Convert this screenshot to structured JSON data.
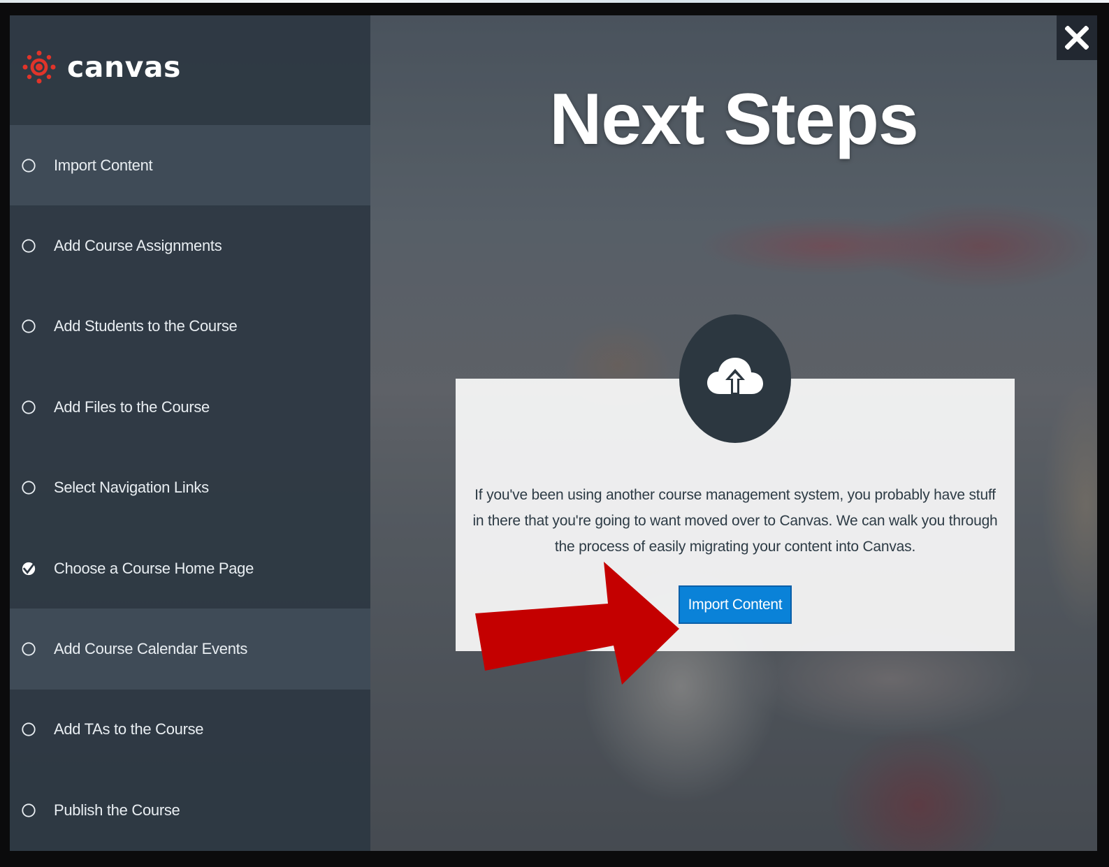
{
  "brand": {
    "name": "canvas"
  },
  "page": {
    "title": "Next Steps"
  },
  "steps": [
    {
      "label": "Import Content",
      "status": "open",
      "active": true
    },
    {
      "label": "Add Course Assignments",
      "status": "open",
      "active": false
    },
    {
      "label": "Add Students to the Course",
      "status": "open",
      "active": false
    },
    {
      "label": "Add Files to the Course",
      "status": "open",
      "active": false
    },
    {
      "label": "Select Navigation Links",
      "status": "open",
      "active": false
    },
    {
      "label": "Choose a Course Home Page",
      "status": "done",
      "active": false
    },
    {
      "label": "Add Course Calendar Events",
      "status": "open",
      "active": true
    },
    {
      "label": "Add TAs to the Course",
      "status": "open",
      "active": false
    },
    {
      "label": "Publish the Course",
      "status": "open",
      "active": false
    }
  ],
  "card": {
    "icon": "cloud-upload-icon",
    "description": "If you've been using another course management system, you probably have stuff in there that you're going to want moved over to Canvas. We can walk you through the process of easily migrating your content into Canvas.",
    "button_label": "Import Content"
  },
  "colors": {
    "brand_red": "#e1342a",
    "button_blue": "#0a82d8",
    "annotation_arrow": "#c40000",
    "sidebar": "#2c3742"
  }
}
